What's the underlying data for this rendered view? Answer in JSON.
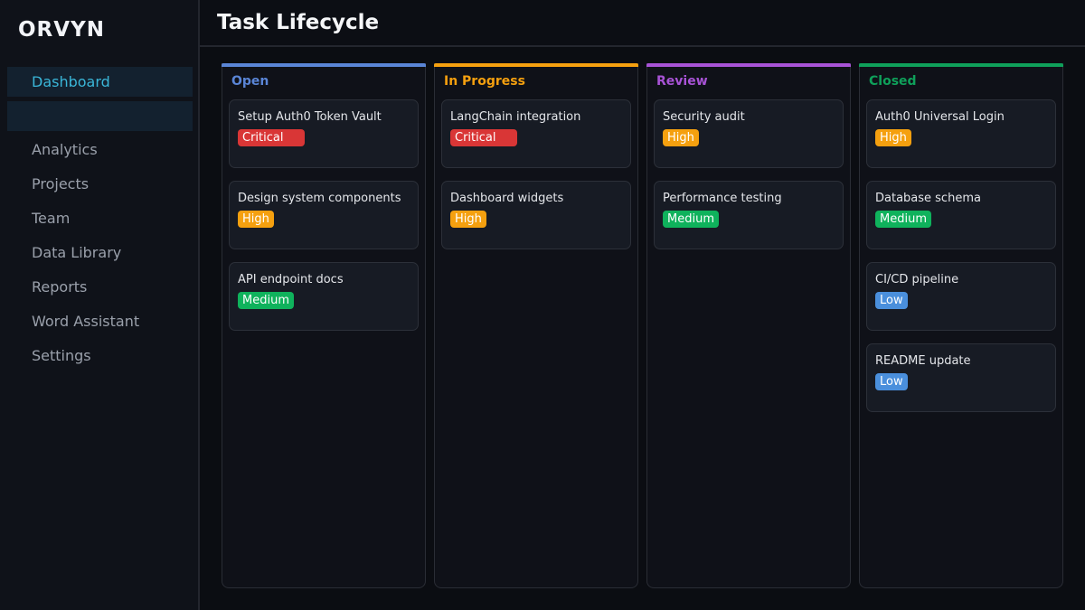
{
  "app": {
    "brand": "ORVYN"
  },
  "sidebar": {
    "items": [
      {
        "label": "Dashboard"
      },
      {
        "label": ""
      },
      {
        "label": "Analytics"
      },
      {
        "label": "Projects"
      },
      {
        "label": "Team"
      },
      {
        "label": "Data Library"
      },
      {
        "label": "Reports"
      },
      {
        "label": "Word Assistant"
      },
      {
        "label": "Settings"
      }
    ]
  },
  "header": {
    "title": "Task Lifecycle"
  },
  "priority_colors": {
    "Critical": "#d93636",
    "High": "#f5a00f",
    "Medium": "#0fb25c",
    "Low": "#4a8fdc"
  },
  "board": {
    "columns": [
      {
        "title": "Open",
        "color": "#5a85d6",
        "cards": [
          {
            "title": "Setup Auth0 Token Vault",
            "priority": "Critical"
          },
          {
            "title": "Design system components",
            "priority": "High"
          },
          {
            "title": "API endpoint docs",
            "priority": "Medium"
          }
        ]
      },
      {
        "title": "In Progress",
        "color": "#f5a00f",
        "cards": [
          {
            "title": "LangChain integration",
            "priority": "Critical"
          },
          {
            "title": "Dashboard widgets",
            "priority": "High"
          }
        ]
      },
      {
        "title": "Review",
        "color": "#a853d6",
        "cards": [
          {
            "title": "Security audit",
            "priority": "High"
          },
          {
            "title": "Performance testing",
            "priority": "Medium"
          }
        ]
      },
      {
        "title": "Closed",
        "color": "#0fa05a",
        "cards": [
          {
            "title": "Auth0 Universal Login",
            "priority": "High"
          },
          {
            "title": "Database schema",
            "priority": "Medium"
          },
          {
            "title": "CI/CD pipeline",
            "priority": "Low"
          },
          {
            "title": "README update",
            "priority": "Low"
          }
        ]
      }
    ]
  }
}
